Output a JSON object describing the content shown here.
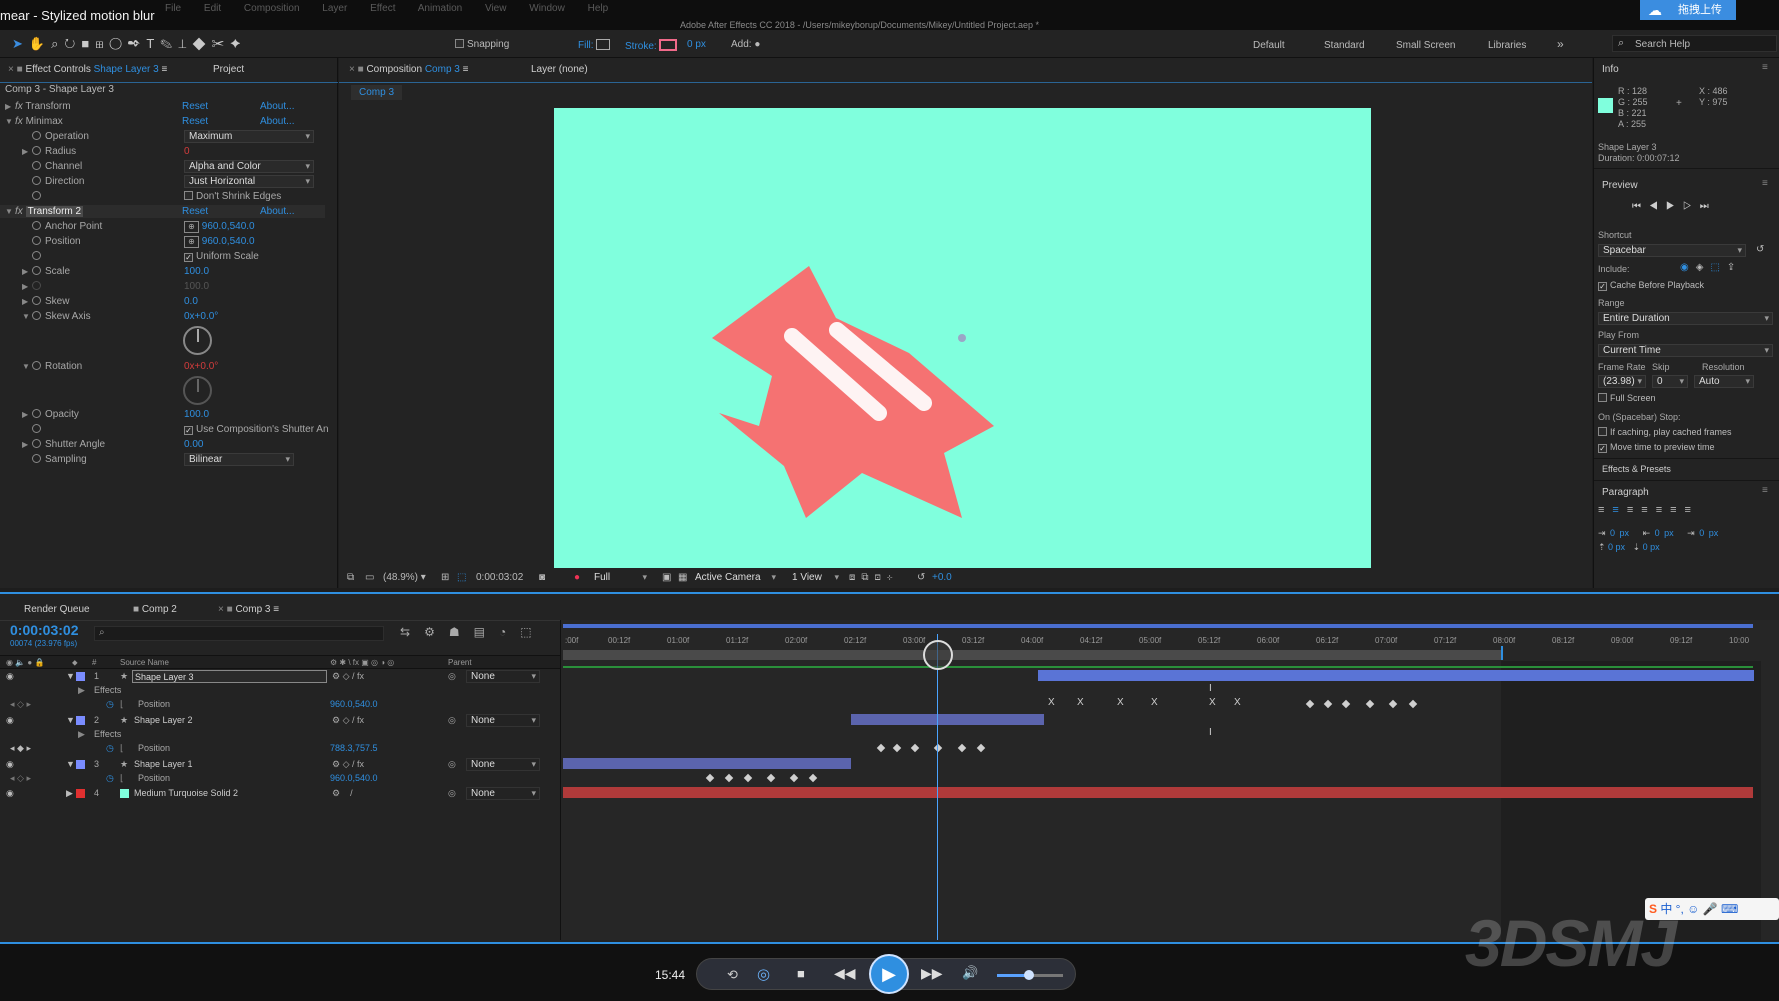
{
  "window": {
    "overlay_title": "mear - Stylized motion blur",
    "app_title": "Adobe After Effects CC 2018 - /Users/mikeyborup/Documents/Mikey/Untitled Project.aep *",
    "upload_label": "拖拽上传"
  },
  "menubar": [
    "File",
    "Edit",
    "Composition",
    "Layer",
    "Effect",
    "Animation",
    "View",
    "Window",
    "Help"
  ],
  "toolbar": {
    "snapping": "Snapping",
    "fill": "Fill:",
    "stroke": "Stroke:",
    "stroke_px": "0 px",
    "add": "Add:",
    "workspaces": [
      "Default",
      "Standard",
      "Small Screen",
      "Libraries"
    ],
    "search_placeholder": "Search Help"
  },
  "effect_controls": {
    "tab_label": "Effect Controls",
    "tab_layer": "Shape Layer 3",
    "project_tab": "Project",
    "subtitle": "Comp 3 - Shape Layer 3",
    "reset": "Reset",
    "about": "About...",
    "transform": "Transform",
    "minimax": "Minimax",
    "operation": "Operation",
    "operation_val": "Maximum",
    "radius": "Radius",
    "radius_val": "0",
    "channel": "Channel",
    "channel_val": "Alpha and Color",
    "direction": "Direction",
    "direction_val": "Just Horizontal",
    "dont_shrink": "Don't Shrink Edges",
    "transform2": "Transform 2",
    "anchor": "Anchor Point",
    "anchor_val": "960.0,540.0",
    "position": "Position",
    "position_val": "960.0,540.0",
    "uniform": "Uniform Scale",
    "scale": "Scale",
    "scale_val": "100.0",
    "scale_val2": "100.0",
    "skew": "Skew",
    "skew_val": "0.0",
    "skew_axis": "Skew Axis",
    "skew_axis_val": "0x+0.0°",
    "rotation": "Rotation",
    "rotation_val": "0x+0.0°",
    "opacity": "Opacity",
    "opacity_val": "100.0",
    "use_comp_shutter": "Use Composition's Shutter An",
    "shutter_angle": "Shutter Angle",
    "shutter_val": "0.00",
    "sampling": "Sampling",
    "sampling_val": "Bilinear"
  },
  "composition": {
    "tab_label": "Composition",
    "tab_comp": "Comp 3",
    "layer_tab": "Layer (none)",
    "breadcrumb": "Comp 3",
    "zoom": "(48.9%)",
    "time": "0:00:03:02",
    "quality": "Full",
    "camera": "Active Camera",
    "views": "1 View",
    "exposure": "+0.0"
  },
  "info": {
    "title": "Info",
    "r": "R : 128",
    "g": "G : 255",
    "b": "B : 221",
    "a": "A : 255",
    "x": "X : 486",
    "y": "Y : 975",
    "swatch": "#80ffdd",
    "layer": "Shape Layer 3",
    "duration": "Duration: 0:00:07:12"
  },
  "preview": {
    "title": "Preview",
    "shortcut_label": "Shortcut",
    "shortcut_val": "Spacebar",
    "include": "Include:",
    "cache": "Cache Before Playback",
    "range_label": "Range",
    "range_val": "Entire Duration",
    "play_from_label": "Play From",
    "play_from_val": "Current Time",
    "frame_rate_label": "Frame Rate",
    "skip_label": "Skip",
    "resolution_label": "Resolution",
    "frame_rate_val": "(23.98)",
    "skip_val": "0",
    "resolution_val": "Auto",
    "full_screen": "Full Screen",
    "on_stop": "On (Spacebar) Stop:",
    "if_caching": "If caching, play cached frames",
    "move_time": "Move time to preview time"
  },
  "effects_presets": "Effects & Presets",
  "paragraph": {
    "title": "Paragraph",
    "px": "0 px"
  },
  "timeline": {
    "tabs": [
      "Render Queue",
      "Comp 2",
      "Comp 3"
    ],
    "timecode": "0:00:03:02",
    "fps": "00074 (23.976 fps)",
    "col_source": "Source Name",
    "col_parent": "Parent",
    "ticks": [
      ":00f",
      "00:12f",
      "01:00f",
      "01:12f",
      "02:00f",
      "02:12f",
      "03:00f",
      "03:12f",
      "04:00f",
      "04:12f",
      "05:00f",
      "05:12f",
      "06:00f",
      "06:12f",
      "07:00f",
      "07:12f",
      "08:00f",
      "08:12f",
      "09:00f",
      "09:12f",
      "10:00"
    ],
    "layers": [
      {
        "num": "1",
        "name": "Shape Layer 3",
        "color": "#7a8cff",
        "parent": "None"
      },
      {
        "num": "2",
        "name": "Shape Layer 2",
        "color": "#7a8cff",
        "parent": "None"
      },
      {
        "num": "3",
        "name": "Shape Layer 1",
        "color": "#7a8cff",
        "parent": "None"
      },
      {
        "num": "4",
        "name": "Medium Turquoise Solid 2",
        "color": "#e03030",
        "parent": "None"
      }
    ],
    "effects_label": "Effects",
    "position_label": "Position",
    "pos1": "960.0,540.0",
    "pos2": "788.3,757.5",
    "pos3": "960.0,540.0"
  },
  "player": {
    "time": "15:44"
  },
  "watermark": "3DSMJ"
}
